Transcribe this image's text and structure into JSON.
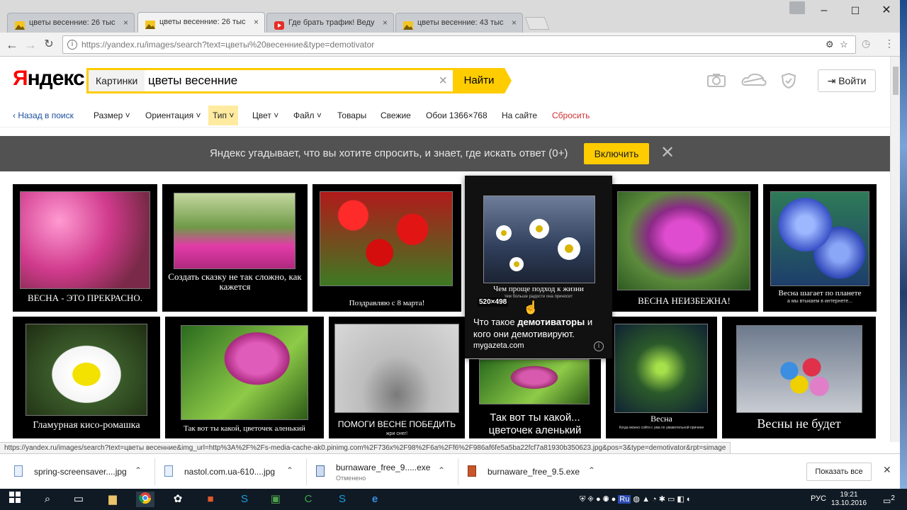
{
  "browser": {
    "tabs": [
      {
        "title": "цветы весенние: 26 тыс",
        "active": false
      },
      {
        "title": "цветы весенние: 26 тыс",
        "active": true
      },
      {
        "title": "Где брать трафик! Веду",
        "active": false
      },
      {
        "title": "цветы весенние: 43 тыс",
        "active": false
      }
    ],
    "tab_close": "×",
    "window": {
      "minimize": "–",
      "maximize": "☐",
      "close": "✕"
    },
    "url": "https://yandex.ru/images/search?text=цветы%20весенние&type=demotivator"
  },
  "header": {
    "logo_first": "Я",
    "logo_rest": "ндекс",
    "service": "Картинки",
    "query": "цветы весенние",
    "clear": "×",
    "search_button": "Найти",
    "login": "Войти"
  },
  "filters": {
    "back": "‹ Назад в поиск",
    "size": "Размер ˅",
    "orientation": "Ориентация ˅",
    "type": "Тип ˅",
    "color": "Цвет ˅",
    "file": "Файл ˅",
    "goods": "Товары",
    "fresh": "Свежие",
    "wallpaper": "Обои 1366×768",
    "onsite": "На сайте",
    "reset": "Сбросить"
  },
  "banner": {
    "text": "Яндекс угадывает, что вы хотите спросить, и знает, где искать ответ (0+)",
    "enable": "Включить",
    "close": "✕"
  },
  "images": [
    {
      "caption": "ВЕСНА - ЭТО ПРЕКРАСНО.",
      "sub": ""
    },
    {
      "caption": "Создать сказку не так сложно, как кажется",
      "sub": ""
    },
    {
      "caption": "Поздравляю с 8 марта!",
      "sub": ""
    },
    {
      "caption": "ВЕСНА НЕИЗБЕЖНА!",
      "sub": ""
    },
    {
      "caption": "Весна шагает по планете",
      "sub": "а мы втыкаем в интернете..."
    },
    {
      "caption": "Гламурная кисо-ромашка",
      "sub": ""
    },
    {
      "caption": "Так вот ты какой, цветочек аленький",
      "sub": ""
    },
    {
      "caption": "ПОМОГИ ВЕСНЕ ПОБЕДИТЬ",
      "sub": "жри снег!"
    },
    {
      "caption": "Так вот ты какой... цветочек аленький",
      "sub": ""
    },
    {
      "caption": "Весна",
      "sub": "Когда можно сойти с ума по уважительной причине"
    },
    {
      "caption": "Весны не будет",
      "sub": ""
    }
  ],
  "hover_card": {
    "caption": "Чем проще подход к жизни",
    "sub": "тем больше радости она приносит",
    "size": "520×498",
    "desc_prefix": "Что такое ",
    "desc_bold": "демотиваторы",
    "desc_suffix": " и кого они демотивируют.",
    "host": "mygazeta.com",
    "info": "i"
  },
  "status_url": "https://yandex.ru/images/search?text=цветы весенние&img_url=http%3A%2F%2Fs-media-cache-ak0.pinimg.com%2F736x%2F98%2F6a%2Ff6%2F986af6fe5a5ba22fcf7a81930b350623.jpg&pos=3&type=demotivator&rpt=simage",
  "downloads": [
    {
      "name": "spring-screensaver....jpg",
      "status": ""
    },
    {
      "name": "nastol.com.ua-610....jpg",
      "status": ""
    },
    {
      "name": "burnaware_free_9.....exe",
      "status": "Отменено"
    },
    {
      "name": "burnaware_free_9.5.exe",
      "status": ""
    }
  ],
  "downloads_show_all": "Показать все",
  "downloads_close": "✕",
  "taskbar": {
    "lang": "РУС",
    "time": "19:21",
    "date": "13.10.2016",
    "notifications": "2"
  }
}
